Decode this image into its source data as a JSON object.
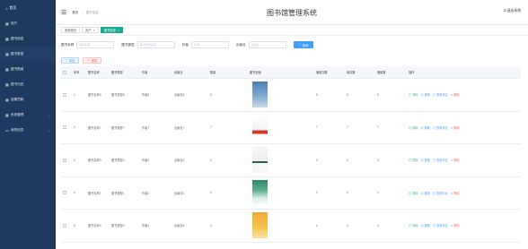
{
  "sidebar": {
    "logo_label": "首页",
    "items": [
      {
        "label": "首页",
        "icon": "home-icon"
      },
      {
        "label": "用户",
        "icon": "user-icon"
      },
      {
        "label": "图书信息",
        "icon": "book-icon"
      },
      {
        "label": "图书类型",
        "icon": "grid-icon"
      },
      {
        "label": "图书借阅",
        "icon": "borrow-icon"
      },
      {
        "label": "图书归还",
        "icon": "return-icon"
      },
      {
        "label": "逾期罚款",
        "icon": "fine-icon"
      },
      {
        "label": "系统管理",
        "icon": "settings-icon"
      },
      {
        "label": "我的信息",
        "icon": "profile-icon"
      }
    ]
  },
  "header": {
    "breadcrumb": [
      "首页",
      "图书信息"
    ],
    "title": "图书馆管理系统",
    "logout_label": "退出系统"
  },
  "tags": [
    {
      "label": "系统首页",
      "active": false
    },
    {
      "label": "用户",
      "active": false
    },
    {
      "label": "图书信息",
      "active": true
    }
  ],
  "search": {
    "name_label": "图书名称",
    "name_placeholder": "图书名称",
    "type_label": "图书类型",
    "type_placeholder": "图书类型名称",
    "author_label": "作者",
    "author_placeholder": "作者",
    "publisher_label": "出版社",
    "publisher_placeholder": "出版社",
    "search_button": "查询"
  },
  "actions": {
    "add": "增加",
    "delete": "删除"
  },
  "table": {
    "columns": [
      "序号",
      "图书名称",
      "图书类型",
      "作者",
      "出版社",
      "数量",
      "图书封面",
      "借阅次数",
      "库存数",
      "借阅数",
      "操作"
    ],
    "rows": [
      {
        "no": "1",
        "name": "图书名称5",
        "type": "图书类型5",
        "author": "作者5",
        "publisher": "出版社5",
        "count": "5",
        "location": "5",
        "stock": "5",
        "borrowed": "5"
      },
      {
        "no": "2",
        "name": "图书名称7",
        "type": "图书类型7",
        "author": "作者7",
        "publisher": "出版社7",
        "count": "7",
        "location": "7",
        "stock": "7",
        "borrowed": "7"
      },
      {
        "no": "3",
        "name": "图书名称3",
        "type": "图书类型3",
        "author": "作者3",
        "publisher": "出版社3",
        "count": "3",
        "location": "3",
        "stock": "3",
        "borrowed": "3"
      },
      {
        "no": "4",
        "name": "图书名称1",
        "type": "图书类型1",
        "author": "作者1",
        "publisher": "出版社1",
        "count": "1",
        "location": "1",
        "stock": "1",
        "borrowed": "1"
      },
      {
        "no": "5",
        "name": "图书名称4",
        "type": "图书类型4",
        "author": "作者4",
        "publisher": "出版社4",
        "count": "4",
        "location": "4",
        "stock": "4",
        "borrowed": "4"
      }
    ],
    "op_labels": {
      "detail": "详情",
      "update": "更新",
      "comments": "查看评论",
      "delete": "删除"
    }
  },
  "colors": {
    "sidebar": "#1e3a5f",
    "accent": "#19a98e",
    "primary": "#409eff",
    "danger": "#f56c6c"
  }
}
